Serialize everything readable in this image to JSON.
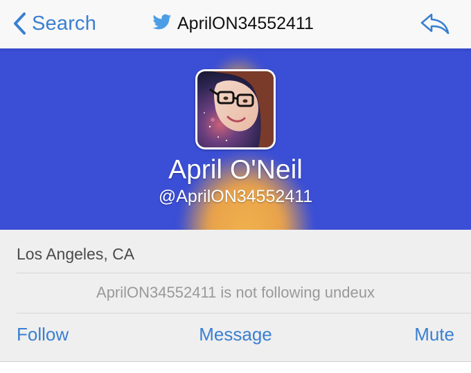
{
  "nav": {
    "back_label": "Search",
    "back_icon": "chevron-left-icon",
    "title": "AprilON34552411",
    "title_icon": "twitter-bird-icon",
    "reply_icon": "reply-icon"
  },
  "profile": {
    "display_name": "April O'Neil",
    "handle": "@AprilON34552411",
    "avatar": "avatar-photo"
  },
  "info": {
    "location": "Los Angeles, CA",
    "follow_status": "AprilON34552411 is not following undeux"
  },
  "actions": {
    "follow_label": "Follow",
    "message_label": "Message",
    "mute_label": "Mute"
  },
  "colors": {
    "accent": "#3a7fd1",
    "banner": "#3a4ed6",
    "panel": "#efefef",
    "twitter_blue": "#4b9ee6"
  }
}
